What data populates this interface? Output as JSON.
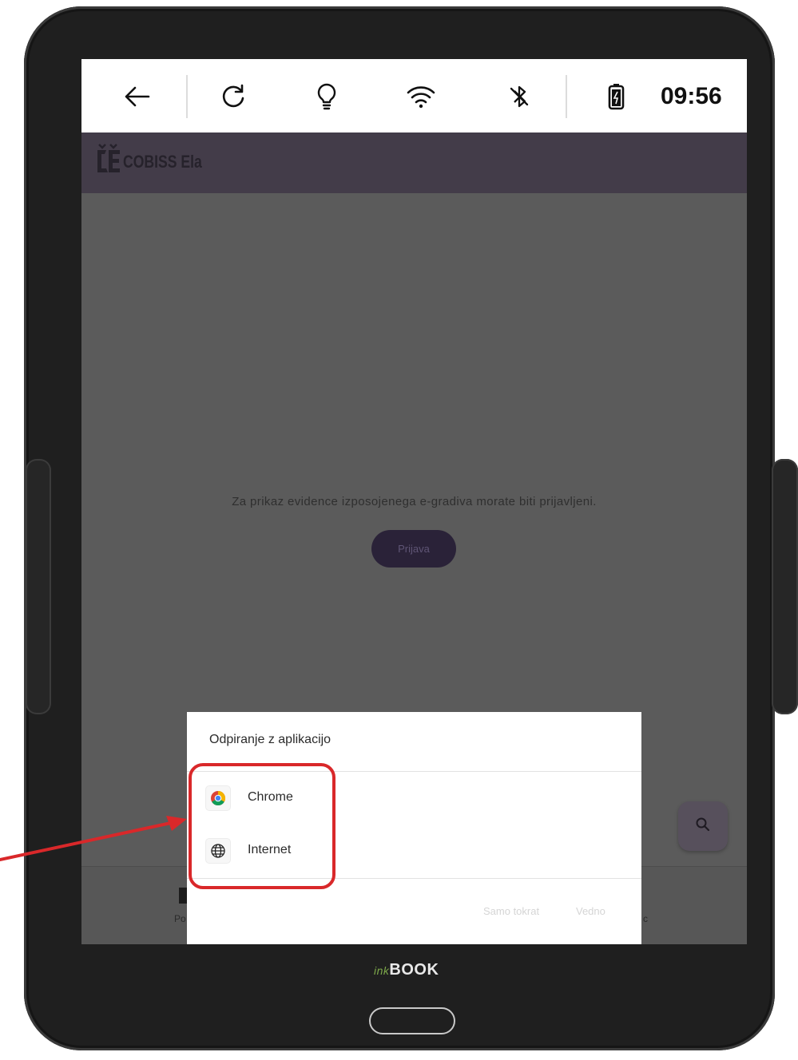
{
  "status_bar": {
    "icons": [
      "back-arrow-icon",
      "refresh-icon",
      "light-bulb-icon",
      "wifi-icon",
      "bluetooth-off-icon",
      "battery-icon"
    ],
    "time": "09:56"
  },
  "app": {
    "logo_text": "COBISS Ela",
    "login_message": "Za prikaz evidence izposojenega e-gradiva morate biti prijavljeni.",
    "login_button": "Prijava",
    "search_icon": "search-icon"
  },
  "bottom_nav": {
    "left_label": "Po",
    "right_label": "c"
  },
  "dialog": {
    "title": "Odpiranje z aplikacijo",
    "options": [
      {
        "label": "Chrome",
        "icon": "chrome-icon"
      },
      {
        "label": "Internet",
        "icon": "globe-icon"
      }
    ],
    "actions": {
      "once": "Samo tokrat",
      "always": "Vedno"
    }
  },
  "annotation": {
    "highlight_color": "#d9282a"
  },
  "device": {
    "brand_prefix": "ink",
    "brand_name": "BOOK"
  }
}
